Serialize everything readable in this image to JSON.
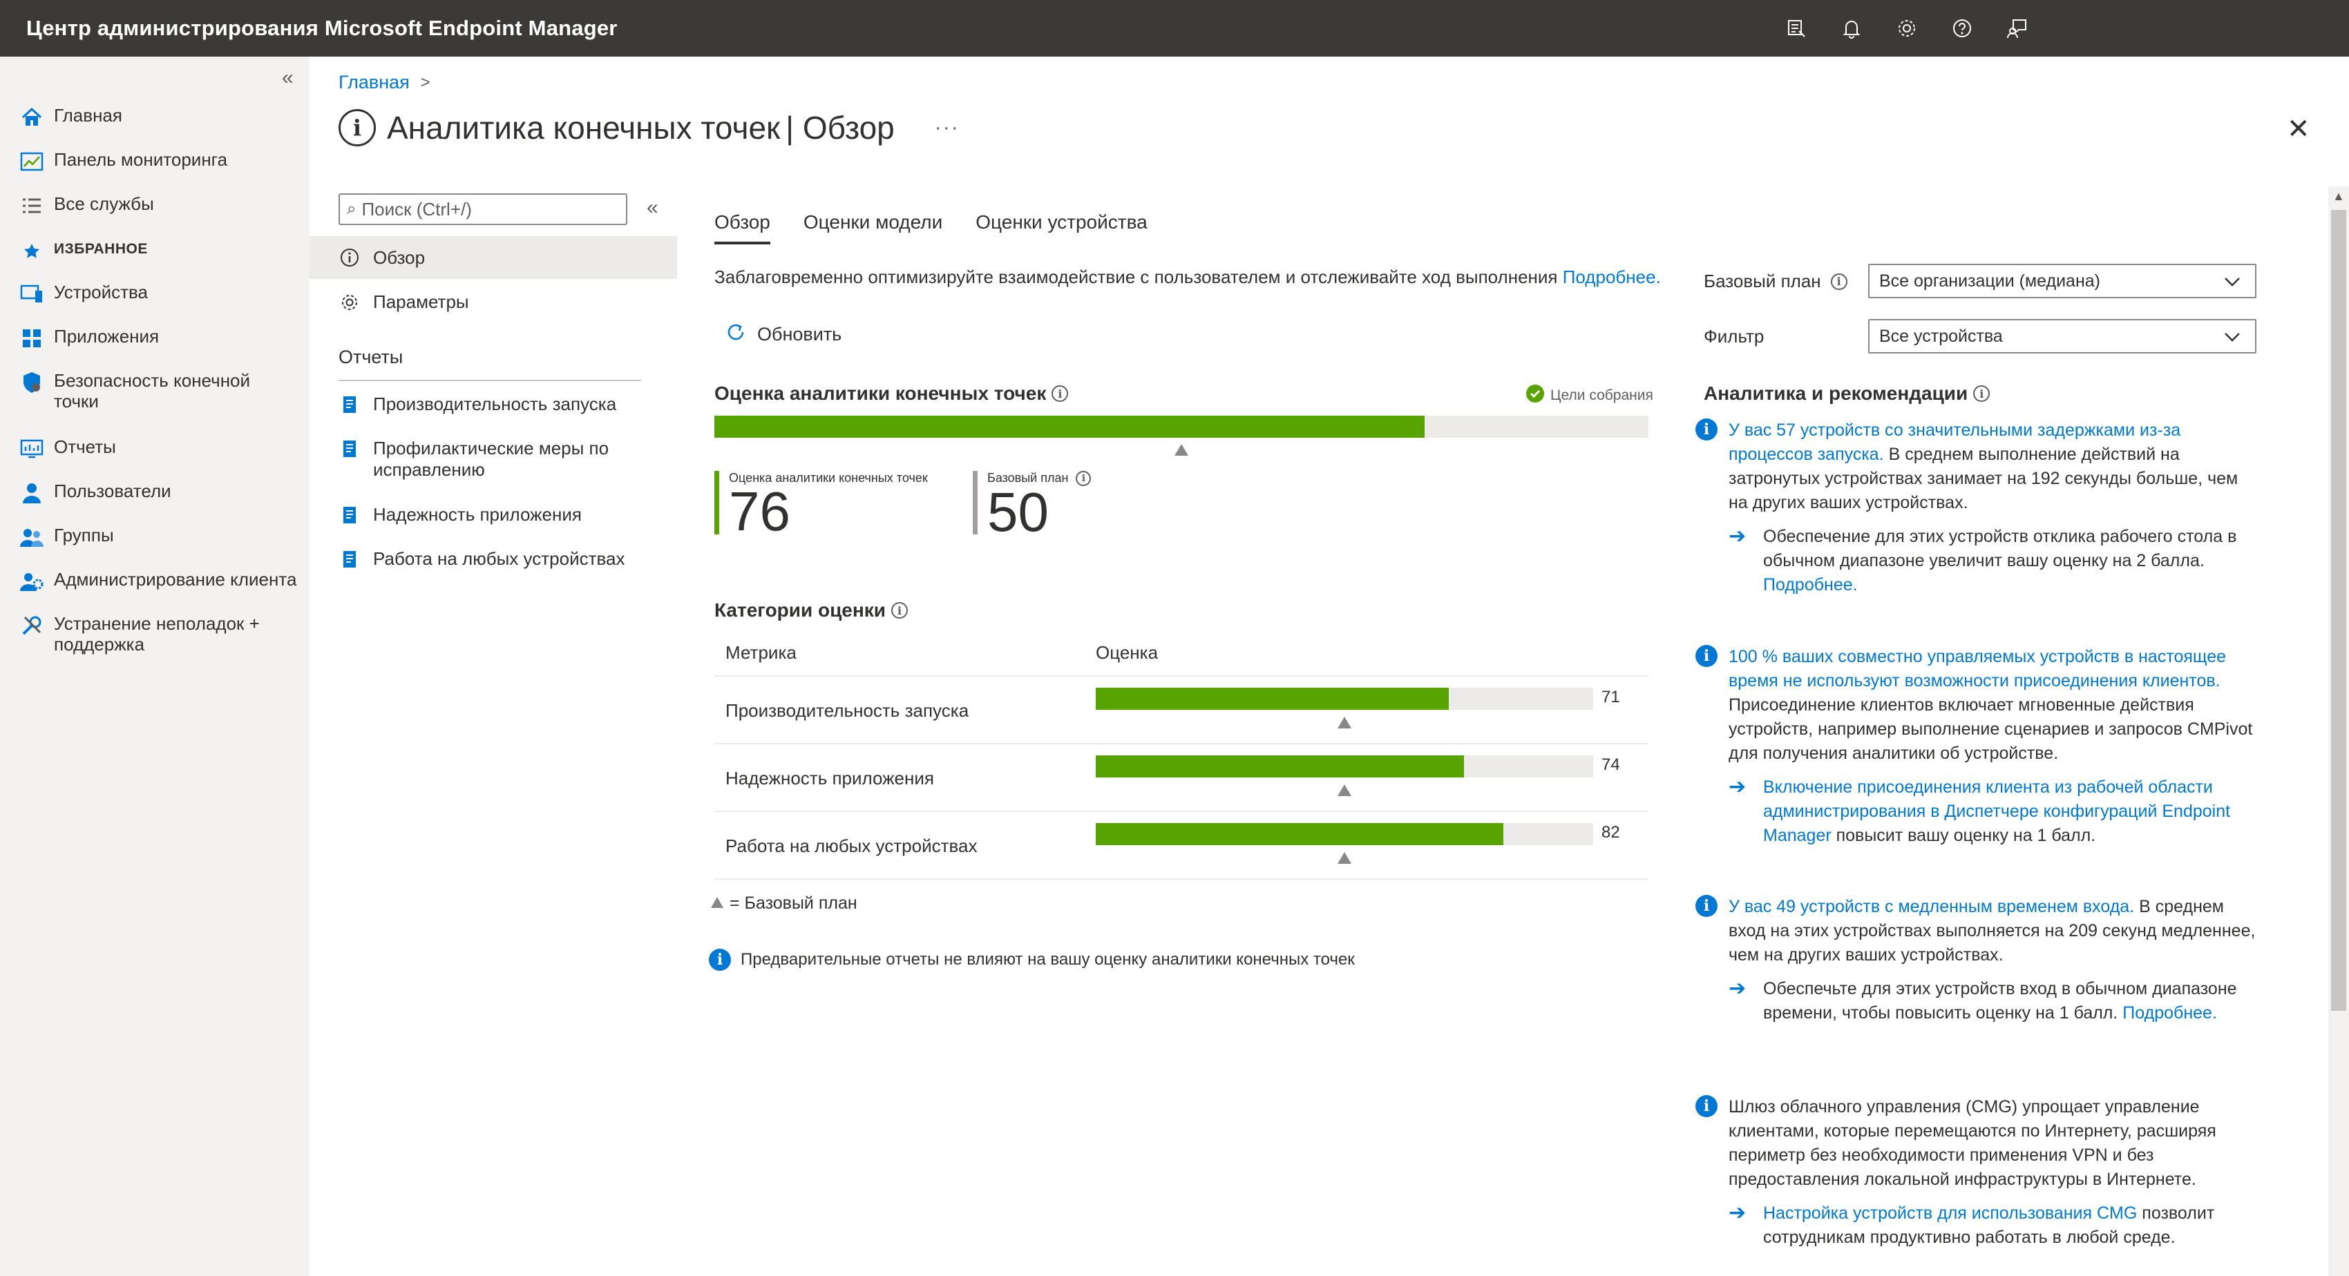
{
  "app": {
    "title": "Центр администрирования Microsoft Endpoint Manager"
  },
  "topbar": {
    "icons": [
      "feedback-portal-icon",
      "bell-icon",
      "gear-icon",
      "help-icon",
      "person-feedback-icon"
    ]
  },
  "leftnav": {
    "items": [
      {
        "label": "Главная",
        "icon": "home-icon"
      },
      {
        "label": "Панель мониторинга",
        "icon": "dashboard-icon"
      },
      {
        "label": "Все службы",
        "icon": "list-icon"
      },
      {
        "label": "ИЗБРАННОЕ",
        "icon": "star-icon"
      },
      {
        "label": "Устройства",
        "icon": "devices-icon"
      },
      {
        "label": "Приложения",
        "icon": "apps-icon"
      },
      {
        "label": "Безопасность конечной точки",
        "icon": "shield-icon"
      },
      {
        "label": "Отчеты",
        "icon": "reports-icon"
      },
      {
        "label": "Пользователи",
        "icon": "user-icon"
      },
      {
        "label": "Группы",
        "icon": "group-icon"
      },
      {
        "label": "Администрирование клиента",
        "icon": "tenant-admin-icon"
      },
      {
        "label": "Устранение неполадок + поддержка",
        "icon": "wrench-icon"
      }
    ]
  },
  "breadcrumb": {
    "home": "Главная"
  },
  "page": {
    "title": "Аналитика конечных точек",
    "subtitle": "| Обзор",
    "more": "···"
  },
  "secnav": {
    "search_placeholder": "Поиск (Ctrl+/)",
    "overview": "Обзор",
    "settings": "Параметры",
    "reports_header": "Отчеты",
    "reports": [
      "Производительность запуска",
      "Профилактические меры по исправлению",
      "Надежность приложения",
      "Работа на любых устройствах"
    ]
  },
  "tabs": [
    "Обзор",
    "Оценки модели",
    "Оценки устройства"
  ],
  "description": {
    "text": "Заблаговременно оптимизируйте взаимодействие с пользователем и отслеживайте ход выполнения ",
    "link": "Подробнее."
  },
  "refresh_label": "Обновить",
  "score": {
    "header": "Оценка аналитики конечных точек",
    "goals_label": "Цели собрания",
    "value": 76,
    "baseline": 50,
    "kpi_label": "Оценка аналитики конечных точек",
    "baseline_label": "Базовый план",
    "value_text": "76",
    "baseline_text": "50"
  },
  "categories": {
    "header": "Категории оценки",
    "col_metric": "Метрика",
    "col_score": "Оценка",
    "rows": [
      {
        "name": "Производительность запуска",
        "score": 71,
        "score_text": "71",
        "baseline": 50
      },
      {
        "name": "Надежность приложения",
        "score": 74,
        "score_text": "74",
        "baseline": 50
      },
      {
        "name": "Работа на любых устройствах",
        "score": 82,
        "score_text": "82",
        "baseline": 50
      }
    ],
    "legend": "= Базовый план"
  },
  "prelim_note": "Предварительные отчеты не влияют на вашу оценку аналитики конечных точек",
  "filters": {
    "baseline_label": "Базовый план",
    "baseline_value": "Все организации (медиана)",
    "filter_label": "Фильтр",
    "filter_value": "Все устройства"
  },
  "insights": {
    "header": "Аналитика и рекомендации",
    "items": [
      {
        "link": "У вас 57 устройств со значительными задержками из-за процессов запуска.",
        "text": " В среднем выполнение действий на затронутых устройствах занимает на 192 секунды больше, чем на других ваших устройствах.",
        "rec_text": "Обеспечение для этих устройств отклика рабочего стола в обычном диапазоне увеличит вашу оценку на 2 балла. ",
        "rec_link": "Подробнее."
      },
      {
        "link": "100 % ваших совместно управляемых устройств в настоящее время не используют возможности присоединения клиентов.",
        "text": " Присоединение клиентов включает мгновенные действия устройств, например выполнение сценариев и запросов CMPivot для получения аналитики об устройстве.",
        "rec_link": "Включение присоединения клиента из рабочей области администрирования в Диспетчере конфигураций Endpoint Manager",
        "rec_text": " повысит вашу оценку на 1 балл."
      },
      {
        "link": "У вас 49 устройств с медленным временем входа.",
        "text": " В среднем вход на этих устройствах выполняется на 209 секунд медленнее, чем на других ваших устройствах.",
        "rec_text": "Обеспечьте для этих устройств вход в обычном диапазоне времени, чтобы повысить оценку на 1 балл. ",
        "rec_link": "Подробнее."
      },
      {
        "text": "Шлюз облачного управления (CMG) упрощает управление клиентами, которые перемещаются по Интернету, расширяя периметр без необходимости применения VPN и без предоставления локальной инфраструктуры в Интернете.",
        "rec_link": "Настройка устройств для использования CMG",
        "rec_text": " позволит сотрудникам продуктивно работать в любой среде."
      }
    ]
  },
  "colors": {
    "topbar": "#3b3a39",
    "accent": "#0078d4",
    "bar_fill": "#57a300",
    "bar_track": "#edebe9",
    "baseline_kpi": "#a19f9d"
  }
}
